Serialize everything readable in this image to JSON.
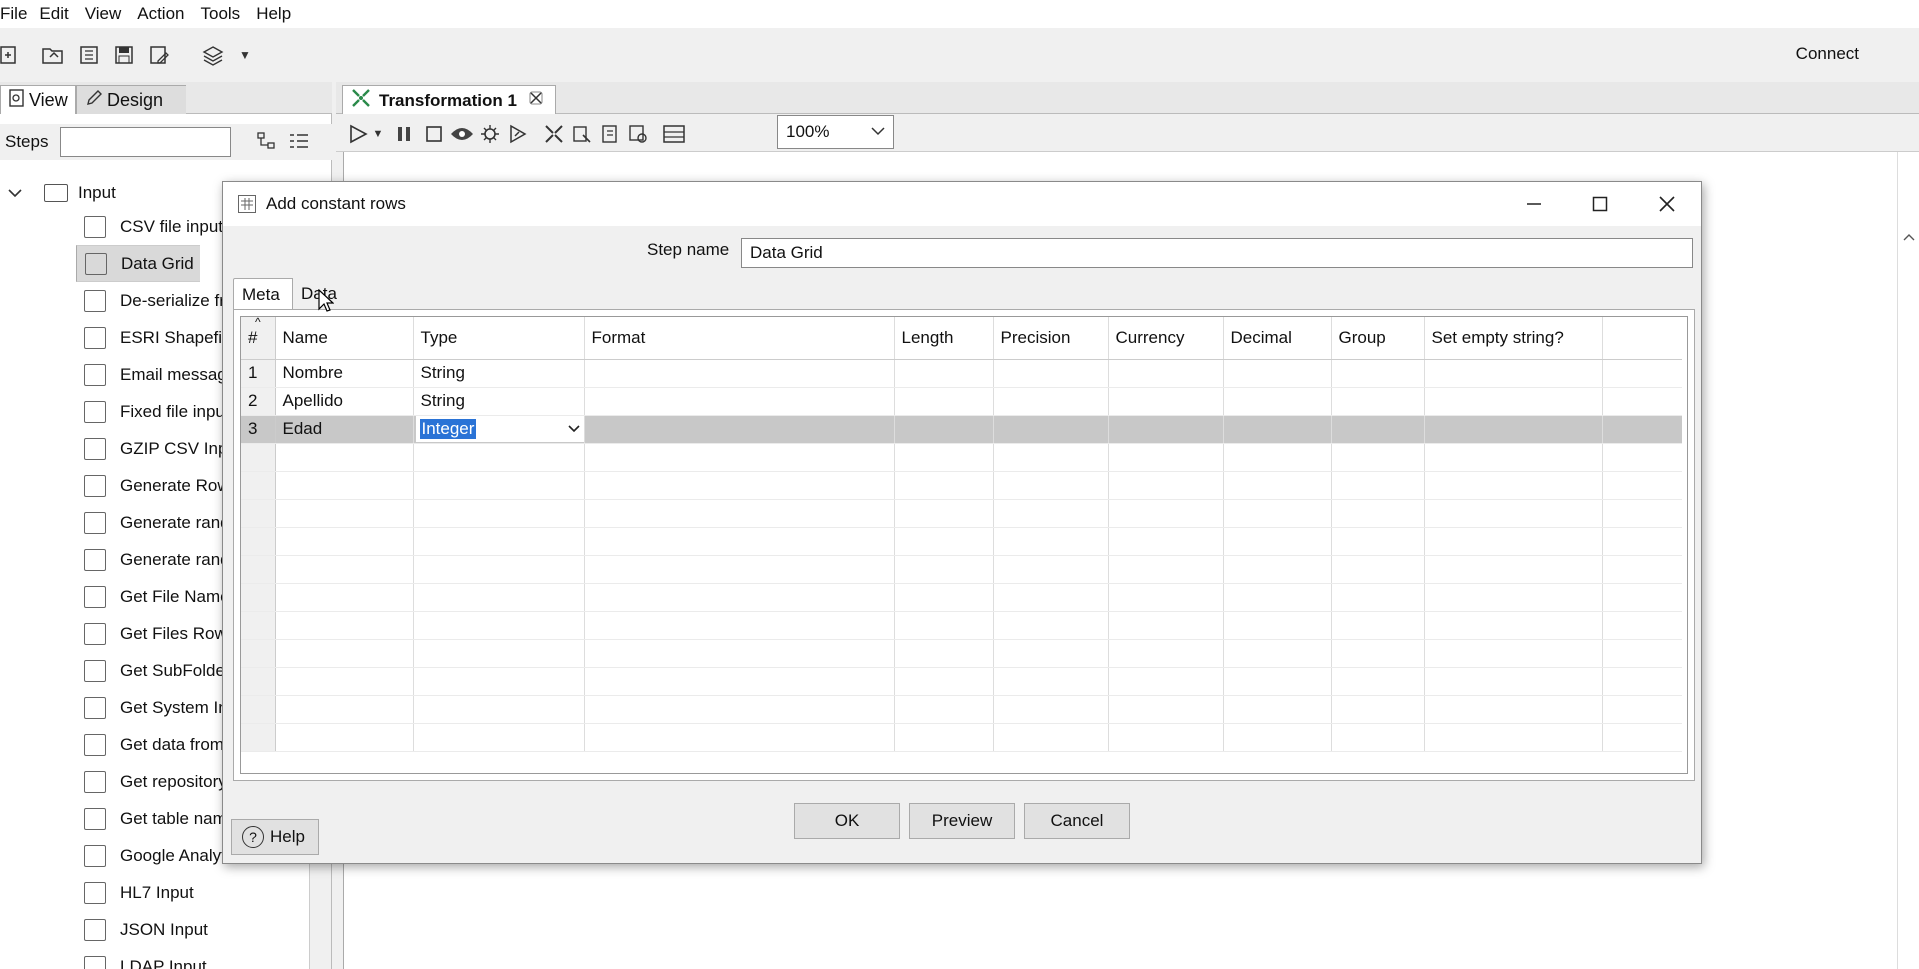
{
  "menu": [
    "File",
    "Edit",
    "View",
    "Action",
    "Tools",
    "Help"
  ],
  "toolbar": {
    "connect_label": "Connect"
  },
  "left_panel": {
    "tabs": {
      "view": "View",
      "design": "Design"
    },
    "steps_label": "Steps",
    "steps_search_value": "",
    "tree_root": "Input",
    "items": [
      "CSV file input",
      "Data Grid",
      "De-serialize from file",
      "ESRI Shapefile Reader",
      "Email messages input",
      "Fixed file input",
      "GZIP CSV Input",
      "Generate Rows",
      "Generate random credit card numbers",
      "Generate random value",
      "Get File Names",
      "Get Files Rows Count",
      "Get SubFolder names",
      "Get System Info",
      "Get data from XML",
      "Get repository names",
      "Get table names",
      "Google Analytics",
      "HL7 Input",
      "JSON Input",
      "LDAP Input"
    ],
    "selected_item": "Data Grid"
  },
  "transformation": {
    "tab_label": "Transformation 1",
    "zoom": "100%"
  },
  "dialog": {
    "title": "Add constant rows",
    "step_name_label": "Step name",
    "step_name_value": "Data Grid",
    "tabs": {
      "meta": "Meta",
      "data": "Data"
    },
    "active_tab": "Meta",
    "columns": [
      "#",
      "Name",
      "Type",
      "Format",
      "Length",
      "Precision",
      "Currency",
      "Decimal",
      "Group",
      "Set empty string?"
    ],
    "rows": [
      {
        "num": "1",
        "name": "Nombre",
        "type": "String"
      },
      {
        "num": "2",
        "name": "Apellido",
        "type": "String"
      },
      {
        "num": "3",
        "name": "Edad",
        "type": "Integer"
      }
    ],
    "buttons": {
      "ok": "OK",
      "preview": "Preview",
      "cancel": "Cancel",
      "help": "Help"
    }
  }
}
